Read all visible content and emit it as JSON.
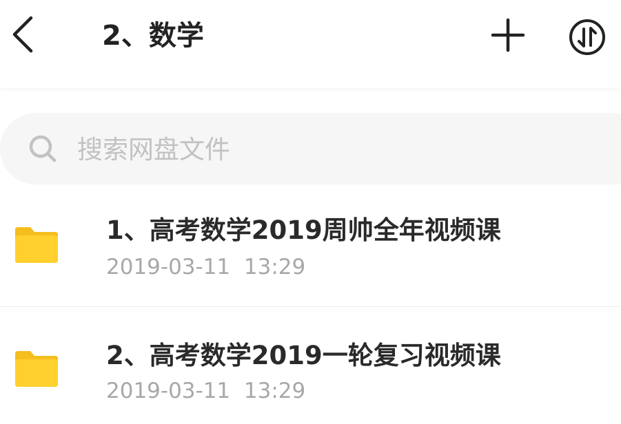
{
  "header": {
    "title": "2、数学",
    "back_icon": "chevron-left-icon",
    "add_icon": "plus-icon",
    "sort_icon": "sort-arrows-circle-icon"
  },
  "search": {
    "placeholder": "搜索网盘文件",
    "value": "",
    "icon": "search-icon"
  },
  "files": [
    {
      "name": "1、高考数学2019周帅全年视频课",
      "date": "2019-03-11",
      "time": "13:29",
      "icon": "folder-icon"
    },
    {
      "name": "2、高考数学2019一轮复习视频课",
      "date": "2019-03-11",
      "time": "13:29",
      "icon": "folder-icon"
    }
  ],
  "colors": {
    "folder": "#FFD02E",
    "folder_tab": "#F5BE1E",
    "text_primary": "#2A2A2A",
    "text_secondary": "#A8A8A8",
    "search_bg": "#F6F6F6"
  }
}
